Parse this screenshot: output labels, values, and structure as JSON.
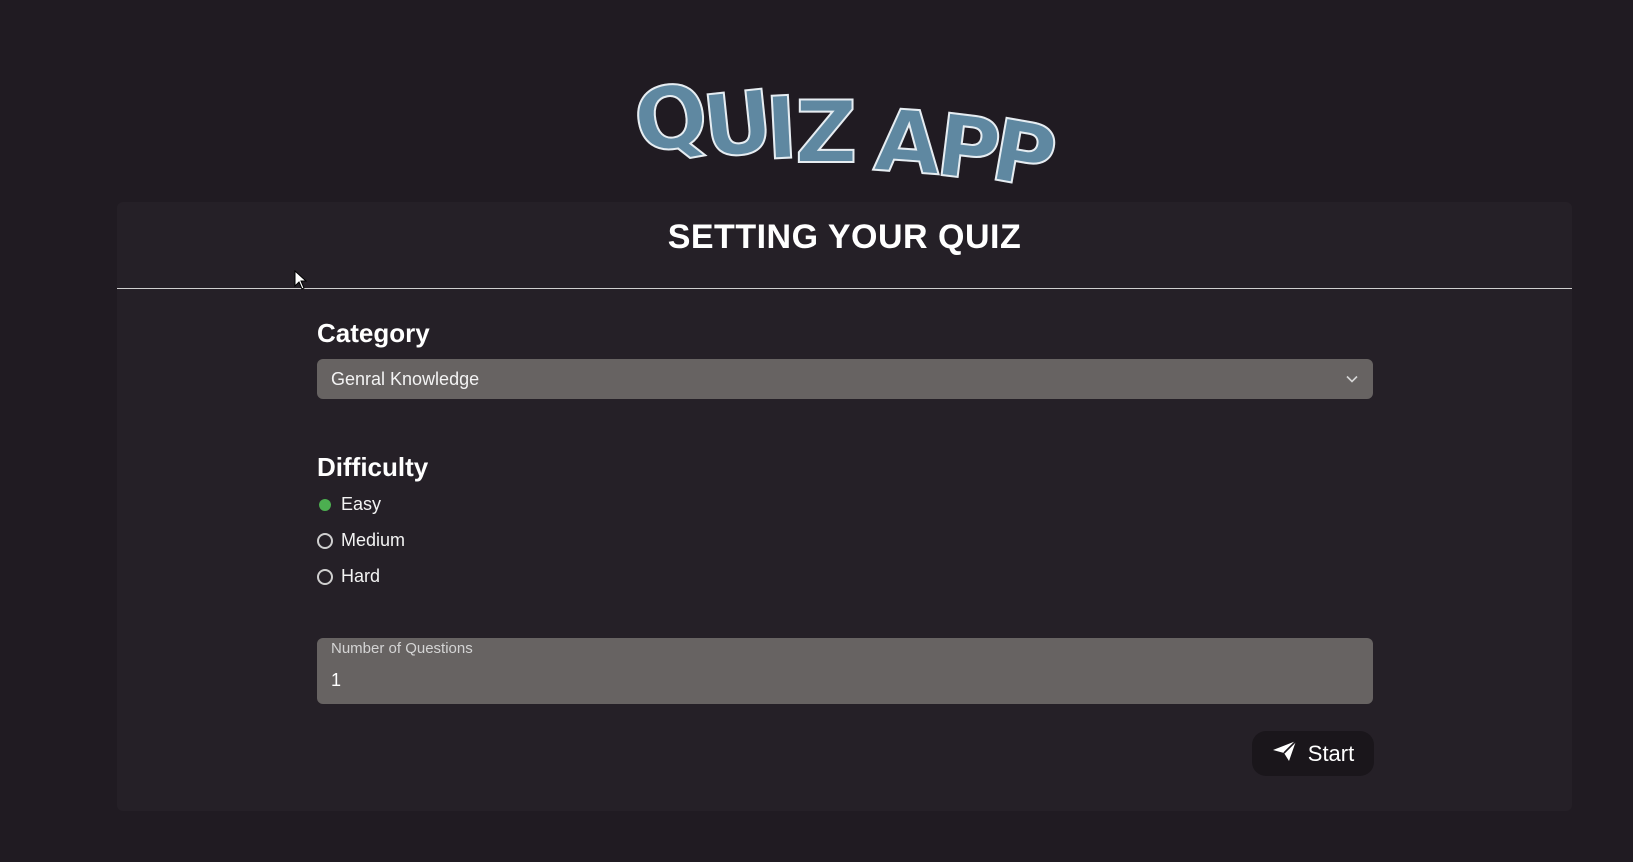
{
  "app": {
    "logo_letters": [
      "Q",
      "U",
      "I",
      "Z",
      " ",
      "A",
      "P",
      "P"
    ]
  },
  "card": {
    "title": "SETTING YOUR QUIZ"
  },
  "category": {
    "label": "Category",
    "selected": "Genral Knowledge",
    "icon": "chevron-down-icon"
  },
  "difficulty": {
    "label": "Difficulty",
    "options": [
      {
        "label": "Easy",
        "checked": true
      },
      {
        "label": "Medium",
        "checked": false
      },
      {
        "label": "Hard",
        "checked": false
      }
    ]
  },
  "questions": {
    "label": "Number of Questions",
    "value": "1"
  },
  "start": {
    "label": "Start",
    "icon": "send-icon"
  },
  "colors": {
    "background": "#201b22",
    "card": "#252027",
    "field": "#676362",
    "accent_radio": "#4caf50",
    "logo_fill": "#5f88a1"
  }
}
